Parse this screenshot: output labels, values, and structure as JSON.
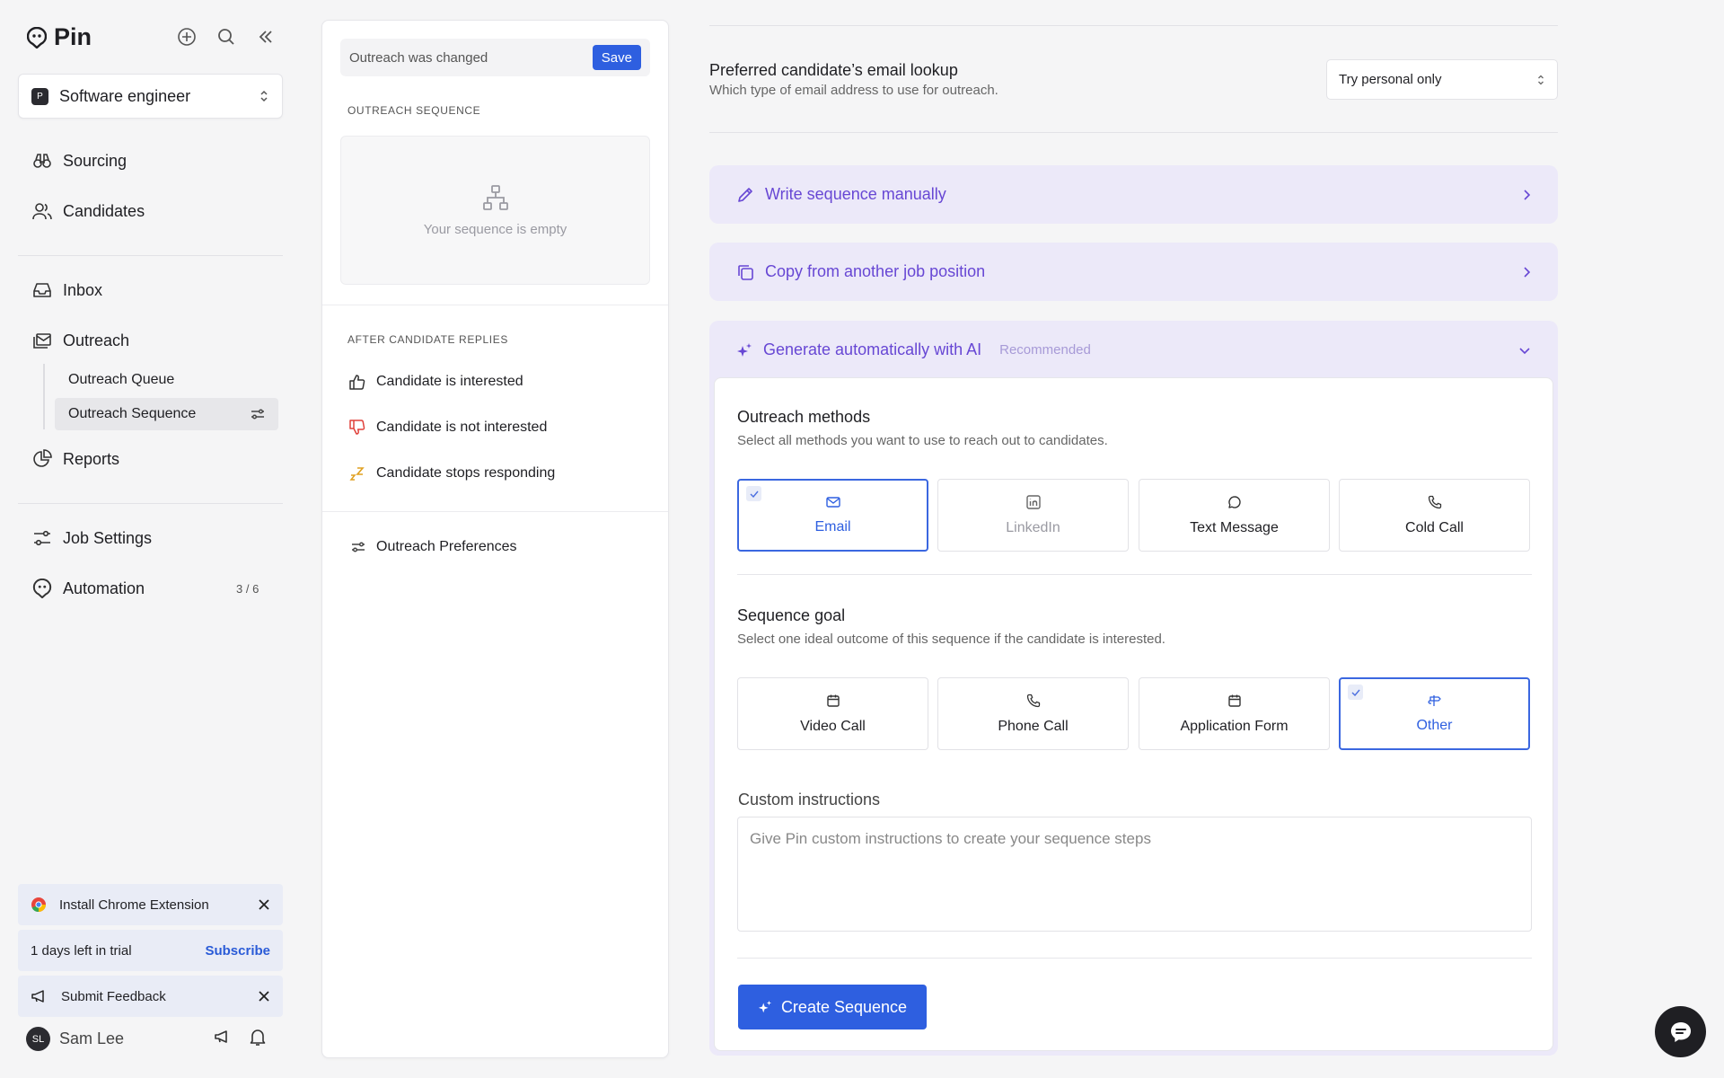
{
  "brand": {
    "name": "Pin"
  },
  "job_select": {
    "badge": "P",
    "label": "Software engineer"
  },
  "nav": {
    "sourcing": "Sourcing",
    "candidates": "Candidates",
    "inbox": "Inbox",
    "outreach": "Outreach",
    "outreach_queue": "Outreach Queue",
    "outreach_sequence": "Outreach Sequence",
    "reports": "Reports",
    "job_settings": "Job Settings",
    "automation": "Automation",
    "automation_count": "3 / 6"
  },
  "promos": {
    "chrome": "Install Chrome Extension",
    "trial": "1 days left in trial",
    "subscribe": "Subscribe",
    "feedback": "Submit Feedback"
  },
  "user": {
    "initials": "SL",
    "name": "Sam Lee"
  },
  "middle": {
    "changed_text": "Outreach was changed",
    "save_label": "Save",
    "sequence_label": "OUTREACH SEQUENCE",
    "empty_text": "Your sequence is empty",
    "after_replies_label": "AFTER CANDIDATE REPLIES",
    "replies": [
      "Candidate is interested",
      "Candidate is not interested",
      "Candidate stops responding"
    ],
    "preferences": "Outreach Preferences"
  },
  "right": {
    "lookup_title": "Preferred candidate’s email lookup",
    "lookup_desc": "Which type of email address to use for outreach.",
    "lookup_value": "Try personal only",
    "write_manual": "Write sequence manually",
    "copy_from": "Copy from another job position",
    "generate_ai": "Generate automatically with AI",
    "recommended": "Recommended",
    "methods_title": "Outreach methods",
    "methods_desc": "Select all methods you want to use to reach out to candidates.",
    "methods": [
      "Email",
      "LinkedIn",
      "Text Message",
      "Cold Call"
    ],
    "goal_title": "Sequence goal",
    "goal_desc": "Select one ideal outcome of this sequence if the candidate is interested.",
    "goals": [
      "Video Call",
      "Phone Call",
      "Application Form",
      "Other"
    ],
    "custom_label": "Custom instructions",
    "custom_placeholder": "Give Pin custom instructions to create your sequence steps",
    "create_label": "Create Sequence"
  },
  "colors": {
    "accent": "#2e5fe0",
    "purple": "#6747d4",
    "purple_bg": "#ece9f9"
  }
}
